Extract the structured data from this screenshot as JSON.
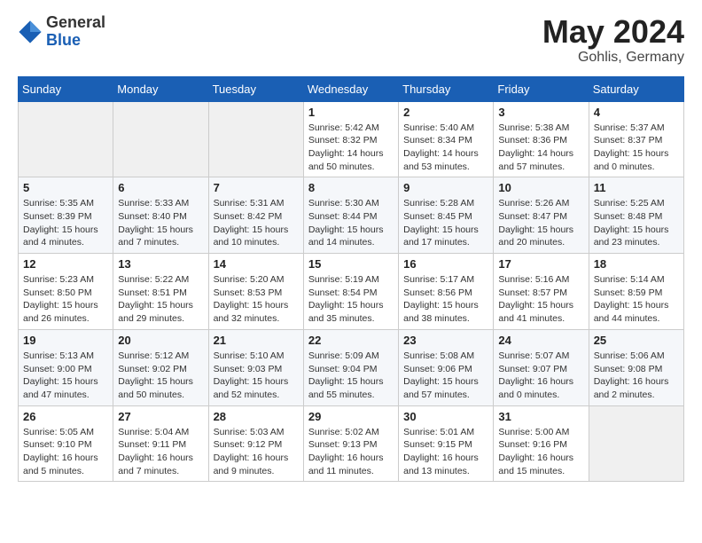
{
  "logo": {
    "general": "General",
    "blue": "Blue"
  },
  "title": "May 2024",
  "location": "Gohlis, Germany",
  "weekdays": [
    "Sunday",
    "Monday",
    "Tuesday",
    "Wednesday",
    "Thursday",
    "Friday",
    "Saturday"
  ],
  "weeks": [
    [
      {
        "day": "",
        "sunrise": "",
        "sunset": "",
        "daylight": ""
      },
      {
        "day": "",
        "sunrise": "",
        "sunset": "",
        "daylight": ""
      },
      {
        "day": "",
        "sunrise": "",
        "sunset": "",
        "daylight": ""
      },
      {
        "day": "1",
        "sunrise": "Sunrise: 5:42 AM",
        "sunset": "Sunset: 8:32 PM",
        "daylight": "Daylight: 14 hours and 50 minutes."
      },
      {
        "day": "2",
        "sunrise": "Sunrise: 5:40 AM",
        "sunset": "Sunset: 8:34 PM",
        "daylight": "Daylight: 14 hours and 53 minutes."
      },
      {
        "day": "3",
        "sunrise": "Sunrise: 5:38 AM",
        "sunset": "Sunset: 8:36 PM",
        "daylight": "Daylight: 14 hours and 57 minutes."
      },
      {
        "day": "4",
        "sunrise": "Sunrise: 5:37 AM",
        "sunset": "Sunset: 8:37 PM",
        "daylight": "Daylight: 15 hours and 0 minutes."
      }
    ],
    [
      {
        "day": "5",
        "sunrise": "Sunrise: 5:35 AM",
        "sunset": "Sunset: 8:39 PM",
        "daylight": "Daylight: 15 hours and 4 minutes."
      },
      {
        "day": "6",
        "sunrise": "Sunrise: 5:33 AM",
        "sunset": "Sunset: 8:40 PM",
        "daylight": "Daylight: 15 hours and 7 minutes."
      },
      {
        "day": "7",
        "sunrise": "Sunrise: 5:31 AM",
        "sunset": "Sunset: 8:42 PM",
        "daylight": "Daylight: 15 hours and 10 minutes."
      },
      {
        "day": "8",
        "sunrise": "Sunrise: 5:30 AM",
        "sunset": "Sunset: 8:44 PM",
        "daylight": "Daylight: 15 hours and 14 minutes."
      },
      {
        "day": "9",
        "sunrise": "Sunrise: 5:28 AM",
        "sunset": "Sunset: 8:45 PM",
        "daylight": "Daylight: 15 hours and 17 minutes."
      },
      {
        "day": "10",
        "sunrise": "Sunrise: 5:26 AM",
        "sunset": "Sunset: 8:47 PM",
        "daylight": "Daylight: 15 hours and 20 minutes."
      },
      {
        "day": "11",
        "sunrise": "Sunrise: 5:25 AM",
        "sunset": "Sunset: 8:48 PM",
        "daylight": "Daylight: 15 hours and 23 minutes."
      }
    ],
    [
      {
        "day": "12",
        "sunrise": "Sunrise: 5:23 AM",
        "sunset": "Sunset: 8:50 PM",
        "daylight": "Daylight: 15 hours and 26 minutes."
      },
      {
        "day": "13",
        "sunrise": "Sunrise: 5:22 AM",
        "sunset": "Sunset: 8:51 PM",
        "daylight": "Daylight: 15 hours and 29 minutes."
      },
      {
        "day": "14",
        "sunrise": "Sunrise: 5:20 AM",
        "sunset": "Sunset: 8:53 PM",
        "daylight": "Daylight: 15 hours and 32 minutes."
      },
      {
        "day": "15",
        "sunrise": "Sunrise: 5:19 AM",
        "sunset": "Sunset: 8:54 PM",
        "daylight": "Daylight: 15 hours and 35 minutes."
      },
      {
        "day": "16",
        "sunrise": "Sunrise: 5:17 AM",
        "sunset": "Sunset: 8:56 PM",
        "daylight": "Daylight: 15 hours and 38 minutes."
      },
      {
        "day": "17",
        "sunrise": "Sunrise: 5:16 AM",
        "sunset": "Sunset: 8:57 PM",
        "daylight": "Daylight: 15 hours and 41 minutes."
      },
      {
        "day": "18",
        "sunrise": "Sunrise: 5:14 AM",
        "sunset": "Sunset: 8:59 PM",
        "daylight": "Daylight: 15 hours and 44 minutes."
      }
    ],
    [
      {
        "day": "19",
        "sunrise": "Sunrise: 5:13 AM",
        "sunset": "Sunset: 9:00 PM",
        "daylight": "Daylight: 15 hours and 47 minutes."
      },
      {
        "day": "20",
        "sunrise": "Sunrise: 5:12 AM",
        "sunset": "Sunset: 9:02 PM",
        "daylight": "Daylight: 15 hours and 50 minutes."
      },
      {
        "day": "21",
        "sunrise": "Sunrise: 5:10 AM",
        "sunset": "Sunset: 9:03 PM",
        "daylight": "Daylight: 15 hours and 52 minutes."
      },
      {
        "day": "22",
        "sunrise": "Sunrise: 5:09 AM",
        "sunset": "Sunset: 9:04 PM",
        "daylight": "Daylight: 15 hours and 55 minutes."
      },
      {
        "day": "23",
        "sunrise": "Sunrise: 5:08 AM",
        "sunset": "Sunset: 9:06 PM",
        "daylight": "Daylight: 15 hours and 57 minutes."
      },
      {
        "day": "24",
        "sunrise": "Sunrise: 5:07 AM",
        "sunset": "Sunset: 9:07 PM",
        "daylight": "Daylight: 16 hours and 0 minutes."
      },
      {
        "day": "25",
        "sunrise": "Sunrise: 5:06 AM",
        "sunset": "Sunset: 9:08 PM",
        "daylight": "Daylight: 16 hours and 2 minutes."
      }
    ],
    [
      {
        "day": "26",
        "sunrise": "Sunrise: 5:05 AM",
        "sunset": "Sunset: 9:10 PM",
        "daylight": "Daylight: 16 hours and 5 minutes."
      },
      {
        "day": "27",
        "sunrise": "Sunrise: 5:04 AM",
        "sunset": "Sunset: 9:11 PM",
        "daylight": "Daylight: 16 hours and 7 minutes."
      },
      {
        "day": "28",
        "sunrise": "Sunrise: 5:03 AM",
        "sunset": "Sunset: 9:12 PM",
        "daylight": "Daylight: 16 hours and 9 minutes."
      },
      {
        "day": "29",
        "sunrise": "Sunrise: 5:02 AM",
        "sunset": "Sunset: 9:13 PM",
        "daylight": "Daylight: 16 hours and 11 minutes."
      },
      {
        "day": "30",
        "sunrise": "Sunrise: 5:01 AM",
        "sunset": "Sunset: 9:15 PM",
        "daylight": "Daylight: 16 hours and 13 minutes."
      },
      {
        "day": "31",
        "sunrise": "Sunrise: 5:00 AM",
        "sunset": "Sunset: 9:16 PM",
        "daylight": "Daylight: 16 hours and 15 minutes."
      },
      {
        "day": "",
        "sunrise": "",
        "sunset": "",
        "daylight": ""
      }
    ]
  ]
}
